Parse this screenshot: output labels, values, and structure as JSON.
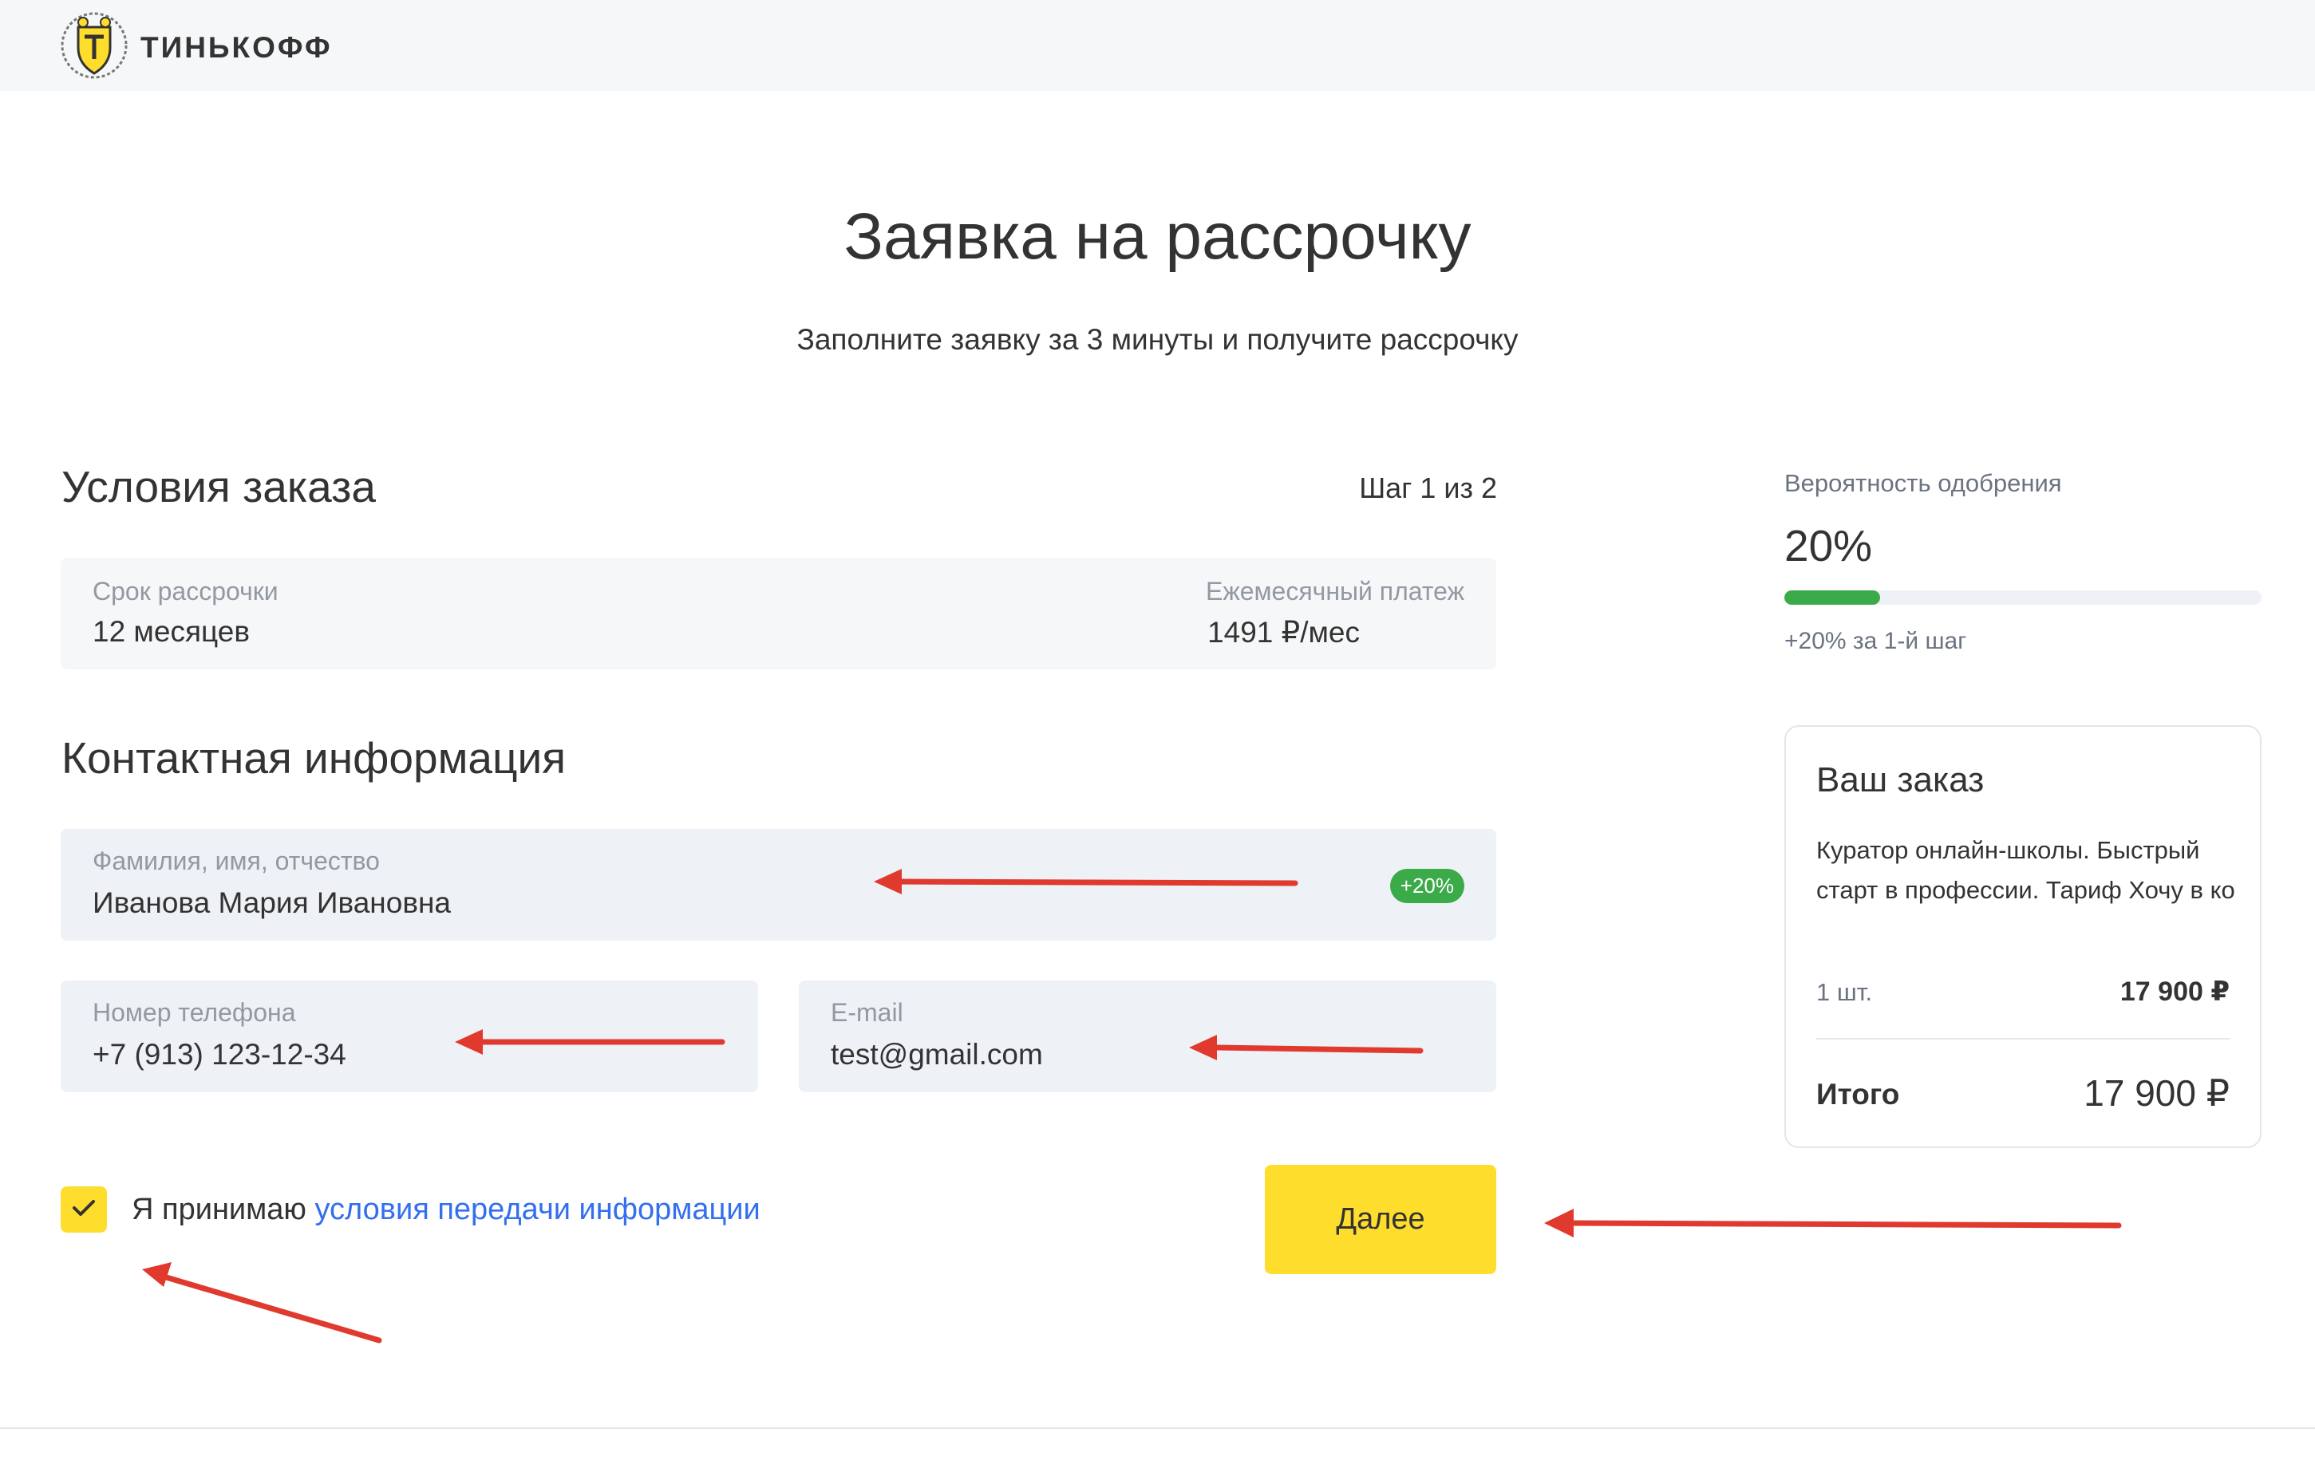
{
  "header": {
    "brand": "ТИНЬКОФФ",
    "logo_icon": "tinkoff-shield-icon"
  },
  "page": {
    "title": "Заявка на рассрочку",
    "subtitle": "Заполните заявку за 3 минуты и получите рассрочку"
  },
  "order_terms": {
    "title": "Условия заказа",
    "step": "Шаг 1 из 2",
    "term_label": "Срок рассрочки",
    "term_value": "12 месяцев",
    "payment_label": "Ежемесячный платеж",
    "payment_value": "1491 ₽/мес"
  },
  "contact": {
    "title": "Контактная информация",
    "fullname_label": "Фамилия, имя, отчество",
    "fullname_value": "Иванова Мария Ивановна",
    "fullname_badge": "+20%",
    "phone_label": "Номер телефона",
    "phone_value": "+7 (913) 123-12-34",
    "email_label": "E-mail",
    "email_value": "test@gmail.com"
  },
  "consent": {
    "checked": true,
    "text": "Я принимаю ",
    "link": "условия передачи информации",
    "check_icon": "checkmark-icon"
  },
  "actions": {
    "next": "Далее"
  },
  "approval": {
    "label": "Вероятность одобрения",
    "value": "20%",
    "progress": 0.2,
    "note": "+20% за 1-й шаг",
    "progress_color": "#3bab49"
  },
  "order": {
    "title": "Ваш заказ",
    "description": "Куратор онлайн-школы. Быстрый старт в профессии. Тариф Хочу в ко",
    "qty": "1 шт.",
    "price": "17 900 ₽",
    "total_label": "Итого",
    "total_value": "17 900 ₽"
  },
  "colors": {
    "accent_yellow": "#ffdd2d",
    "link_blue": "#336fee",
    "success_green": "#3bab49",
    "annotation_red": "#e03a2f"
  }
}
